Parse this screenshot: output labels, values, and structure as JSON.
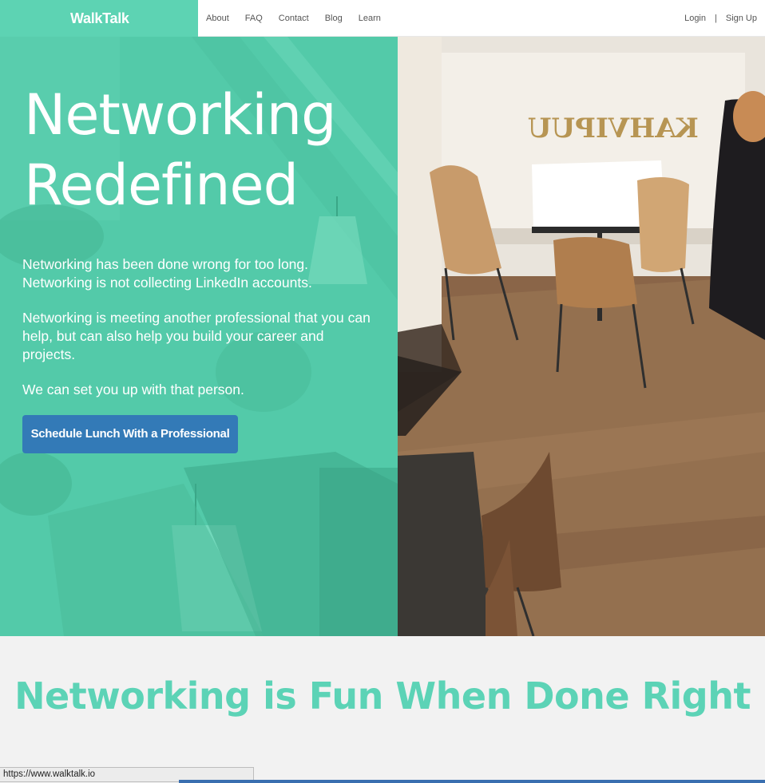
{
  "nav": {
    "brand": "WalkTalk",
    "links": [
      "About",
      "FAQ",
      "Contact",
      "Blog",
      "Learn"
    ],
    "login": "Login",
    "separator": "|",
    "signup": "Sign Up"
  },
  "hero": {
    "title_line1": "Networking",
    "title_line2": "Redefined",
    "paragraph1": "Networking has been done wrong for too long. Networking is not collecting LinkedIn accounts.",
    "paragraph2": "Networking is meeting another professional that you can help, but can also help you build your career and projects.",
    "paragraph3": "We can set you up with that person.",
    "cta_label": "Schedule Lunch With a Professional",
    "photo_sign": "KAHVIPUU"
  },
  "section2": {
    "title": "Networking is Fun When Done Right"
  },
  "status_bar": {
    "url": "https://www.walktalk.io"
  },
  "colors": {
    "brand_teal": "#5dd3b3",
    "hero_overlay": "#52c9a8",
    "cta_blue": "#337ab7",
    "heading_teal": "#5cd3b6"
  }
}
